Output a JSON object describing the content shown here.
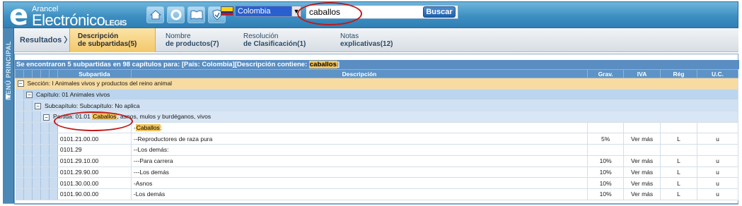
{
  "app": {
    "logo_small": "Arancel",
    "logo_main": "Electrónico",
    "logo_brand": "LEGIS"
  },
  "toolbar": {
    "icons": [
      "home-icon",
      "refresh-icon",
      "book-icon",
      "shield-icon"
    ],
    "country": "Colombia",
    "search_value": "caballos",
    "search_button": "Buscar"
  },
  "sidemenu": {
    "label": "MENÚ PRINCIPAL"
  },
  "tabs": {
    "results": "Resultados",
    "desc": {
      "line1": "Descripción",
      "line2": "de subpartidas(5)"
    },
    "name": {
      "line1": "Nombre",
      "line2": "de productos(7)"
    },
    "res": {
      "line1": "Resolución",
      "line2": "de Clasificación(1)"
    },
    "notes": {
      "line1": "Notas",
      "line2": "explicativas(12)"
    }
  },
  "summary": {
    "prefix": "Se encontraron 5 subpartidas en 98 capítulos para: [País: Colombia][Descripción contiene: ",
    "term": "caballos",
    "suffix": "]"
  },
  "table": {
    "headers": {
      "subpartida": "Subpartida",
      "descripcion": "Descripción",
      "grav": "Grav.",
      "iva": "IVA",
      "reg": "Rég",
      "uc": "U.C."
    },
    "section": "Sección: I Animales vivos y productos del reino animal",
    "chapter": "Capítulo: 01 Animales vivos",
    "subchapter": "Subcapítulo: Subcapítulo: No aplica",
    "partida": {
      "prefix": "Partida: 01.01 ",
      "term": "Caballos",
      "suffix": ", asnos, mulos y burdéganos, vivos"
    },
    "rows": [
      {
        "code": "",
        "desc_hl": "Caballos",
        "desc": "-",
        "desc_after": ":",
        "grav": "",
        "iva": "",
        "reg": "",
        "uc": ""
      },
      {
        "code": "0101.21.00.00",
        "desc": "--Reproductores de raza pura",
        "grav": "5%",
        "iva": "Ver más",
        "reg": "L",
        "uc": "u"
      },
      {
        "code": "0101.29",
        "desc": "--Los demás:",
        "grav": "",
        "iva": "",
        "reg": "",
        "uc": ""
      },
      {
        "code": "0101.29.10.00",
        "desc": "---Para carrera",
        "grav": "10%",
        "iva": "Ver más",
        "reg": "L",
        "uc": "u"
      },
      {
        "code": "0101.29.90.00",
        "desc": "---Los demás",
        "grav": "10%",
        "iva": "Ver más",
        "reg": "L",
        "uc": "u"
      },
      {
        "code": "0101.30.00.00",
        "desc": "-Asnos",
        "grav": "10%",
        "iva": "Ver más",
        "reg": "L",
        "uc": "u"
      },
      {
        "code": "0101.90.00.00",
        "desc": "-Los demás",
        "grav": "10%",
        "iva": "Ver más",
        "reg": "L",
        "uc": "u"
      }
    ]
  }
}
